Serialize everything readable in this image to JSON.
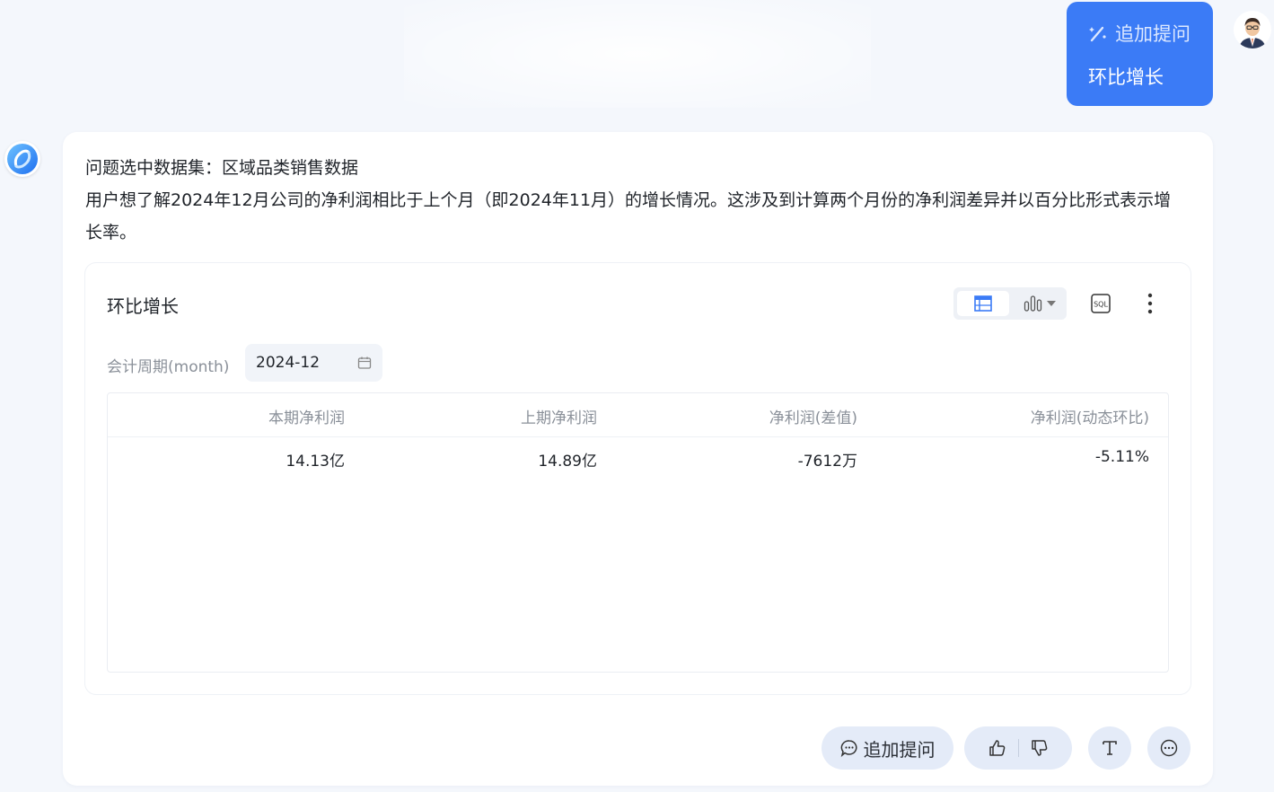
{
  "user_bubble": {
    "follow_label": "追加提问",
    "question": "环比增长"
  },
  "answer": {
    "dataset_line": "问题选中数据集：区域品类销售数据",
    "description": "用户想了解2024年12月公司的净利润相比于上个月（即2024年11月）的增长情况。这涉及到计算两个月份的净利润差异并以百分比形式表示增长率。"
  },
  "card": {
    "title": "环比增长",
    "filter": {
      "label": "会计周期(month)",
      "value": "2024-12"
    },
    "table": {
      "headers": [
        "本期净利润",
        "上期净利润",
        "净利润(差值)",
        "净利润(动态环比)"
      ],
      "rows": [
        [
          "14.13亿",
          "14.89亿",
          "-7612万",
          "-5.11%"
        ]
      ]
    }
  },
  "actions": {
    "follow_label": "追加提问"
  },
  "icons": [
    "wand-icon",
    "user-avatar",
    "bot-logo",
    "table-view-icon",
    "bar-chart-icon",
    "chevron-down-icon",
    "sql-icon",
    "more-vertical-icon",
    "calendar-icon",
    "chat-bubble-icon",
    "thumbs-up-icon",
    "thumbs-down-icon",
    "text-format-icon",
    "more-horizontal-icon"
  ],
  "colors": {
    "primary": "#3b7bf6",
    "background": "#f4f7fc",
    "action_bg": "#e4ebf8"
  }
}
